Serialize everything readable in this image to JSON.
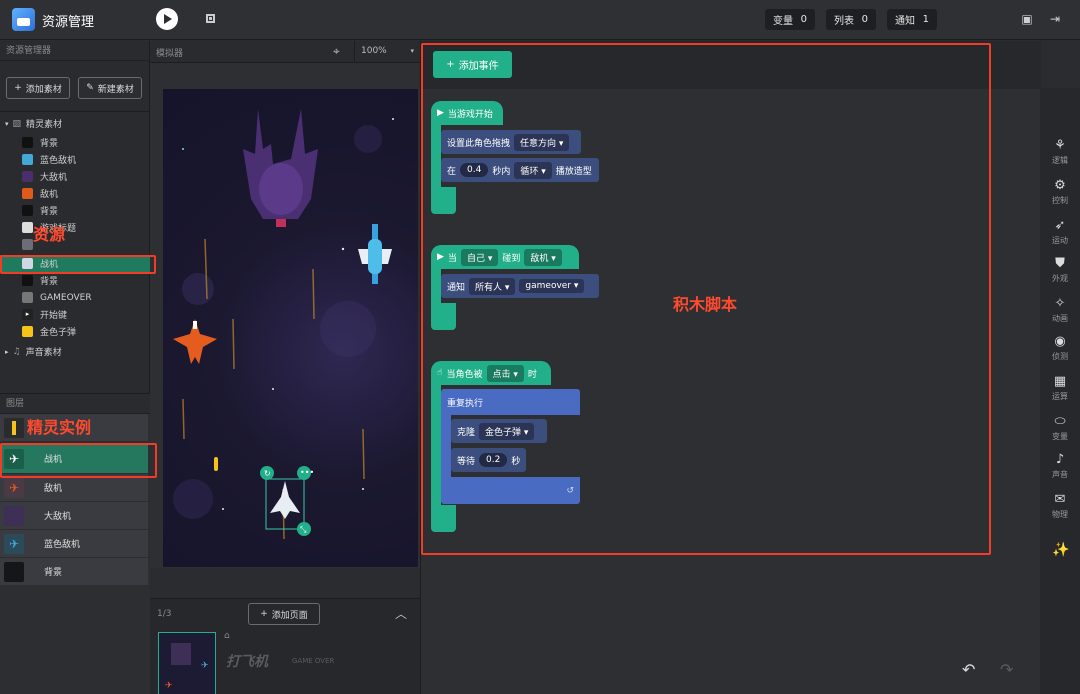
{
  "app": {
    "title": "资源管理"
  },
  "counters": [
    {
      "label": "变量",
      "value": "0"
    },
    {
      "label": "列表",
      "value": "0"
    },
    {
      "label": "通知",
      "value": "1"
    }
  ],
  "asset_panel": {
    "title": "资源管理器",
    "add_asset": "添加素材",
    "new_asset": "新建素材"
  },
  "tree": {
    "sprites_folder": "精灵素材",
    "items": [
      "背景",
      "蓝色敌机",
      "大敌机",
      "敌机",
      "背景",
      "游戏标题",
      "战机",
      "背景",
      "GAMEOVER",
      "开始键",
      "金色子弹"
    ],
    "sound_folder": "声音素材"
  },
  "simulator": {
    "title": "模拟器",
    "zoom": "100%"
  },
  "layers": {
    "title": "图层",
    "items": [
      "",
      "战机",
      "敌机",
      "大敌机",
      "蓝色敌机",
      "背景"
    ]
  },
  "pages": {
    "counter": "1/3",
    "add_page": "添加页面",
    "thumb_text": "打飞机",
    "thumb_text2": "GAME OVER"
  },
  "annotations": {
    "resources": "资源",
    "sprite_instances": "精灵实例",
    "block_script": "积木脚本"
  },
  "script": {
    "add_event": "添加事件",
    "e1": {
      "hat": "当游戏开始",
      "b1_label": "设置此角色拖拽",
      "b1_opt": "任意方向",
      "b2_a": "在",
      "b2_num": "0.4",
      "b2_b": "秒内",
      "b2_opt": "循环",
      "b2_c": "播放造型"
    },
    "e2": {
      "hat_a": "当",
      "hat_opt1": "自己",
      "hat_b": "碰到",
      "hat_opt2": "敌机",
      "b1_label": "通知",
      "b1_opt1": "所有人",
      "b1_opt2": "gameover"
    },
    "e3": {
      "hat_a": "当角色被",
      "hat_opt": "点击",
      "hat_b": "时",
      "repeat": "重复执行",
      "clone": "克隆",
      "clone_opt": "金色子弹",
      "wait": "等待",
      "wait_num": "0.2",
      "wait_unit": "秒"
    }
  },
  "toolbox": [
    "逻辑",
    "控制",
    "运动",
    "外观",
    "动画",
    "侦测",
    "运算",
    "变量",
    "声音",
    "物理"
  ],
  "colors": {
    "accent": "#22b08a",
    "highlight_red": "#f23c27",
    "block_blue": "#3c4e7d"
  }
}
